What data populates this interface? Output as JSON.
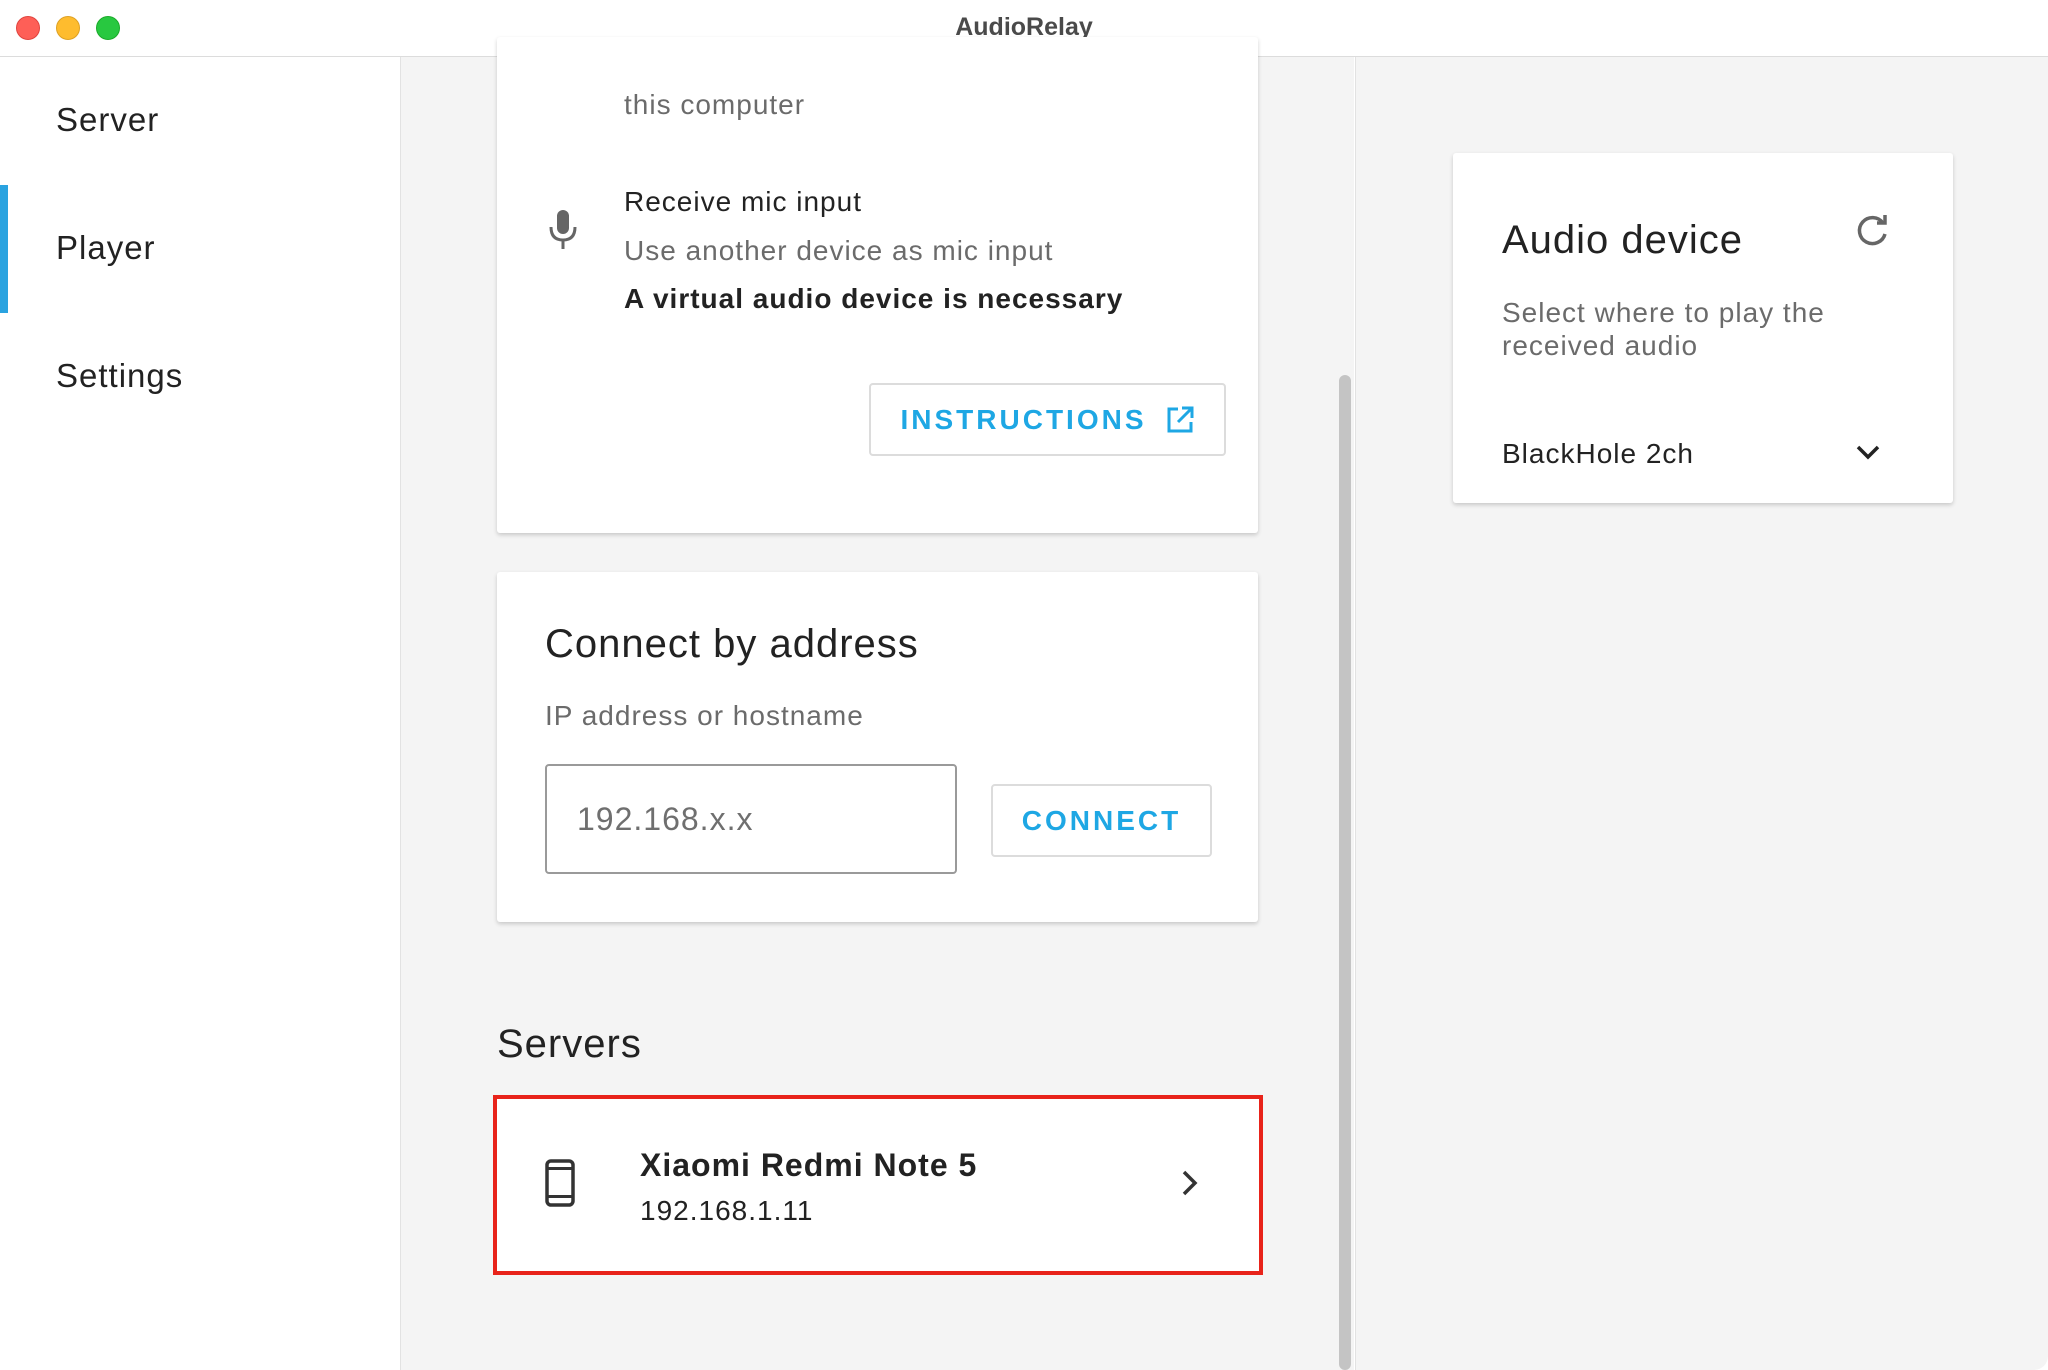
{
  "window": {
    "title": "AudioRelay"
  },
  "sidebar": {
    "items": [
      {
        "label": "Server",
        "active": false
      },
      {
        "label": "Player",
        "active": true
      },
      {
        "label": "Settings",
        "active": false
      }
    ]
  },
  "mic_card": {
    "top_text": "this computer",
    "heading": "Receive mic input",
    "subtitle": "Use another device as mic input",
    "note": "A virtual audio device is necessary",
    "button_label": "INSTRUCTIONS"
  },
  "connect_card": {
    "title": "Connect by address",
    "label": "IP address or hostname",
    "input_placeholder": "192.168.x.x",
    "input_value": "",
    "button_label": "CONNECT"
  },
  "servers": {
    "heading": "Servers",
    "items": [
      {
        "name": "Xiaomi Redmi Note 5",
        "ip": "192.168.1.11"
      }
    ]
  },
  "audio_device": {
    "title": "Audio device",
    "subtitle": "Select where to play the received audio",
    "selected": "BlackHole 2ch"
  },
  "colors": {
    "accent": "#1ea7e4",
    "active_indicator": "#2aa3e0",
    "highlight_border": "#e8231a"
  },
  "icons": {
    "mic": "microphone-icon",
    "external": "external-link-icon",
    "phone": "smartphone-icon",
    "chevron_right": "chevron-right-icon",
    "refresh": "refresh-icon",
    "chevron_down": "chevron-down-icon"
  }
}
